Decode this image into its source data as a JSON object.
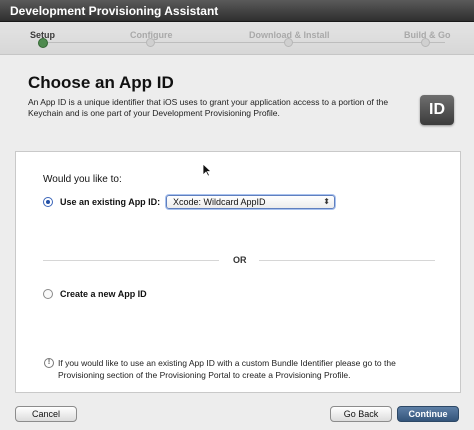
{
  "window": {
    "title": "Development Provisioning Assistant"
  },
  "steps": [
    {
      "label": "Setup",
      "active": true
    },
    {
      "label": "Configure",
      "active": false
    },
    {
      "label": "Download & Install",
      "active": false
    },
    {
      "label": "Build & Go",
      "active": false
    }
  ],
  "header": {
    "title": "Choose an App ID",
    "description": "An App ID is a unique identifier that iOS uses to grant your application access to a portion of the Keychain and is one part of your Development Provisioning Profile.",
    "icon_text": "ID"
  },
  "form": {
    "question": "Would you like to:",
    "option_existing": "Use an existing App ID:",
    "existing_selected": true,
    "select_value": "Xcode: Wildcard AppID",
    "or_label": "OR",
    "option_new": "Create a new App ID",
    "note": "If you would like to use an existing App ID with a custom Bundle Identifier please go to the Provisioning section of the Provisioning Portal to create a Provisioning Profile."
  },
  "buttons": {
    "cancel": "Cancel",
    "back": "Go Back",
    "continue": "Continue"
  }
}
